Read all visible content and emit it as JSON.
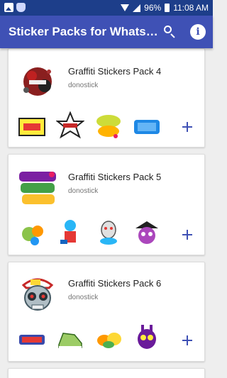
{
  "status_bar": {
    "battery": "96%",
    "time": "11:08 AM"
  },
  "app_bar": {
    "title": "Sticker Packs for Whats…",
    "search_icon": "search-icon",
    "info_icon": "info-icon",
    "info_glyph": "i"
  },
  "packs": [
    {
      "title": "Graffiti Stickers Pack 4",
      "author": "donostick"
    },
    {
      "title": "Graffiti Stickers Pack 5",
      "author": "donostick"
    },
    {
      "title": "Graffiti Stickers Pack 6",
      "author": "donostick"
    }
  ],
  "colors": {
    "primary": "#3f51b5",
    "status_bar": "#1d3e8a",
    "background": "#eeeeee"
  }
}
